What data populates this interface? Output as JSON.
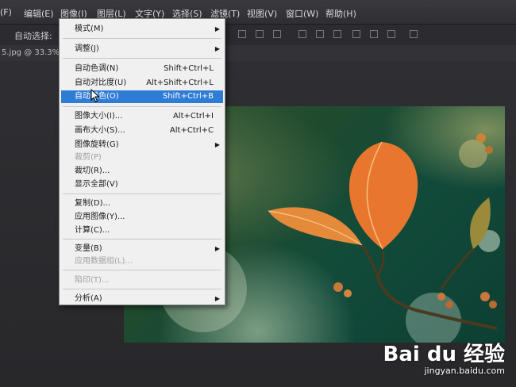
{
  "menubar": {
    "items": [
      "(F)",
      "编辑(E)",
      "图像(I)",
      "图层(L)",
      "文字(Y)",
      "选择(S)",
      "滤镜(T)",
      "视图(V)",
      "窗口(W)",
      "帮助(H)"
    ]
  },
  "options_bar": {
    "auto_select_label": "自动选择:"
  },
  "document_tab": {
    "label": "5.jpg @ 33.3% ("
  },
  "image_menu": {
    "items": [
      {
        "label": "模式(M)",
        "shortcut": "",
        "submenu": true,
        "disabled": false
      },
      {
        "label": "调整(J)",
        "shortcut": "",
        "submenu": true,
        "disabled": false
      },
      {
        "label": "自动色调(N)",
        "shortcut": "Shift+Ctrl+L",
        "submenu": false,
        "disabled": false
      },
      {
        "label": "自动对比度(U)",
        "shortcut": "Alt+Shift+Ctrl+L",
        "submenu": false,
        "disabled": false
      },
      {
        "label": "自动颜色(O)",
        "shortcut": "Shift+Ctrl+B",
        "submenu": false,
        "disabled": false,
        "highlighted": true
      },
      {
        "label": "图像大小(I)...",
        "shortcut": "Alt+Ctrl+I",
        "submenu": false,
        "disabled": false
      },
      {
        "label": "画布大小(S)...",
        "shortcut": "Alt+Ctrl+C",
        "submenu": false,
        "disabled": false
      },
      {
        "label": "图像旋转(G)",
        "shortcut": "",
        "submenu": true,
        "disabled": false
      },
      {
        "label": "裁剪(P)",
        "shortcut": "",
        "submenu": false,
        "disabled": true
      },
      {
        "label": "裁切(R)...",
        "shortcut": "",
        "submenu": false,
        "disabled": false
      },
      {
        "label": "显示全部(V)",
        "shortcut": "",
        "submenu": false,
        "disabled": false
      },
      {
        "label": "复制(D)...",
        "shortcut": "",
        "submenu": false,
        "disabled": false
      },
      {
        "label": "应用图像(Y)...",
        "shortcut": "",
        "submenu": false,
        "disabled": false
      },
      {
        "label": "计算(C)...",
        "shortcut": "",
        "submenu": false,
        "disabled": false
      },
      {
        "label": "变量(B)",
        "shortcut": "",
        "submenu": true,
        "disabled": false
      },
      {
        "label": "应用数据组(L)...",
        "shortcut": "",
        "submenu": false,
        "disabled": true
      },
      {
        "label": "陷印(T)...",
        "shortcut": "",
        "submenu": false,
        "disabled": true
      },
      {
        "label": "分析(A)",
        "shortcut": "",
        "submenu": true,
        "disabled": false
      }
    ]
  },
  "watermark": {
    "logo": "Bai du 经验",
    "url": "jingyan.baidu.com"
  },
  "colors": {
    "highlight": "#2f7cd6",
    "menu_bg": "#f0f0f0",
    "menubar_bg": "#333336"
  }
}
